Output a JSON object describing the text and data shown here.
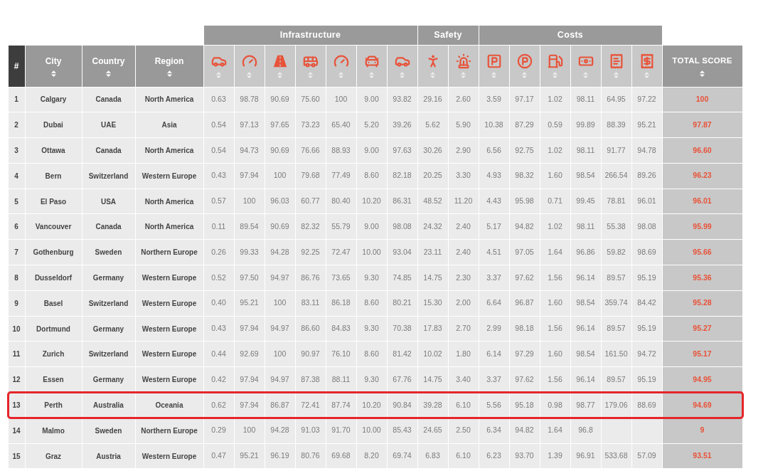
{
  "table": {
    "index_header": "#",
    "text_headers": [
      {
        "label": "City",
        "sortable": true
      },
      {
        "label": "Country",
        "sortable": true
      },
      {
        "label": "Region",
        "sortable": true
      }
    ],
    "groups": [
      {
        "title": "Infrastructure",
        "columns": [
          {
            "sortable": true
          },
          {
            "sortable": true
          },
          {
            "sortable": true
          },
          {
            "sortable": true
          },
          {
            "sortable": true
          },
          {
            "sortable": true
          },
          {
            "sortable": true
          }
        ]
      },
      {
        "title": "Safety",
        "columns": [
          {
            "sortable": true
          },
          {
            "sortable": true
          }
        ]
      },
      {
        "title": "Costs",
        "columns": [
          {
            "sortable": true
          },
          {
            "sortable": true
          },
          {
            "sortable": true
          },
          {
            "sortable": true
          },
          {
            "sortable": true
          },
          {
            "sortable": true
          }
        ]
      }
    ],
    "total_header": {
      "label": "TOTAL SCORE",
      "sortable": true
    },
    "rows": [
      {
        "rank": "1",
        "city": "Calgary",
        "country": "Canada",
        "region": "North America",
        "values": [
          "0.63",
          "98.78",
          "90.69",
          "75.60",
          "100",
          "9.00",
          "93.82",
          "29.16",
          "2.60",
          "3.59",
          "97.17",
          "1.02",
          "98.11",
          "64.95",
          "97.22"
        ],
        "total": "100",
        "highlighted": false
      },
      {
        "rank": "2",
        "city": "Dubai",
        "country": "UAE",
        "region": "Asia",
        "values": [
          "0.54",
          "97.13",
          "97.65",
          "73.23",
          "65.40",
          "5.20",
          "39.26",
          "5.62",
          "5.90",
          "10.38",
          "87.29",
          "0.59",
          "99.89",
          "88.39",
          "95.21"
        ],
        "total": "97.87",
        "highlighted": false
      },
      {
        "rank": "3",
        "city": "Ottawa",
        "country": "Canada",
        "region": "North America",
        "values": [
          "0.54",
          "94.73",
          "90.69",
          "76.66",
          "88.93",
          "9.00",
          "97.63",
          "30.26",
          "2.90",
          "6.56",
          "92.75",
          "1.02",
          "98.11",
          "91.77",
          "94.78"
        ],
        "total": "96.60",
        "highlighted": false
      },
      {
        "rank": "4",
        "city": "Bern",
        "country": "Switzerland",
        "region": "Western Europe",
        "values": [
          "0.43",
          "97.94",
          "100",
          "79.68",
          "77.49",
          "8.60",
          "82.18",
          "20.25",
          "3.30",
          "4.93",
          "98.32",
          "1.60",
          "98.54",
          "266.54",
          "89.26"
        ],
        "total": "96.23",
        "highlighted": false
      },
      {
        "rank": "5",
        "city": "El Paso",
        "country": "USA",
        "region": "North America",
        "values": [
          "0.57",
          "100",
          "96.03",
          "60.77",
          "80.40",
          "10.20",
          "86.31",
          "48.52",
          "11.20",
          "4.43",
          "95.98",
          "0.71",
          "99.45",
          "78.81",
          "96.01"
        ],
        "total": "96.01",
        "highlighted": false
      },
      {
        "rank": "6",
        "city": "Vancouver",
        "country": "Canada",
        "region": "North America",
        "values": [
          "0.11",
          "89.54",
          "90.69",
          "82.32",
          "55.79",
          "9.00",
          "98.08",
          "24.32",
          "2.40",
          "5.17",
          "94.82",
          "1.02",
          "98.11",
          "55.38",
          "98.08"
        ],
        "total": "95.99",
        "highlighted": false
      },
      {
        "rank": "7",
        "city": "Gothenburg",
        "country": "Sweden",
        "region": "Northern Europe",
        "values": [
          "0.26",
          "99.33",
          "94.28",
          "92.25",
          "72.47",
          "10.00",
          "93.04",
          "23.11",
          "2.40",
          "4.51",
          "97.05",
          "1.64",
          "96.86",
          "59.82",
          "98.69"
        ],
        "total": "95.66",
        "highlighted": false
      },
      {
        "rank": "8",
        "city": "Dusseldorf",
        "country": "Germany",
        "region": "Western Europe",
        "values": [
          "0.52",
          "97.50",
          "94.97",
          "86.76",
          "73.65",
          "9.30",
          "74.85",
          "14.75",
          "2.30",
          "3.37",
          "97.62",
          "1.56",
          "96.14",
          "89.57",
          "95.19"
        ],
        "total": "95.36",
        "highlighted": false
      },
      {
        "rank": "9",
        "city": "Basel",
        "country": "Switzerland",
        "region": "Western Europe",
        "values": [
          "0.40",
          "95.21",
          "100",
          "83.11",
          "86.18",
          "8.60",
          "80.21",
          "15.30",
          "2.00",
          "6.64",
          "96.87",
          "1.60",
          "98.54",
          "359.74",
          "84.42"
        ],
        "total": "95.28",
        "highlighted": false
      },
      {
        "rank": "10",
        "city": "Dortmund",
        "country": "Germany",
        "region": "Western Europe",
        "values": [
          "0.43",
          "97.94",
          "94.97",
          "86.60",
          "84.83",
          "9.30",
          "70.38",
          "17.83",
          "2.70",
          "2.99",
          "98.18",
          "1.56",
          "96.14",
          "89.57",
          "95.19"
        ],
        "total": "95.27",
        "highlighted": false
      },
      {
        "rank": "11",
        "city": "Zurich",
        "country": "Switzerland",
        "region": "Western Europe",
        "values": [
          "0.44",
          "92.69",
          "100",
          "90.97",
          "76.10",
          "8.60",
          "81.42",
          "10.02",
          "1.80",
          "6.14",
          "97.29",
          "1.60",
          "98.54",
          "161.50",
          "94.72"
        ],
        "total": "95.17",
        "highlighted": false
      },
      {
        "rank": "12",
        "city": "Essen",
        "country": "Germany",
        "region": "Western Europe",
        "values": [
          "0.42",
          "97.94",
          "94.97",
          "87.38",
          "88.11",
          "9.30",
          "67.76",
          "14.75",
          "3.40",
          "3.37",
          "97.62",
          "1.56",
          "96.14",
          "89.57",
          "95.19"
        ],
        "total": "94.95",
        "highlighted": false
      },
      {
        "rank": "13",
        "city": "Perth",
        "country": "Australia",
        "region": "Oceania",
        "values": [
          "0.62",
          "97.94",
          "86.87",
          "72.41",
          "87.74",
          "10.20",
          "90.84",
          "39.28",
          "6.10",
          "5.56",
          "95.18",
          "0.98",
          "98.77",
          "179.06",
          "88.69"
        ],
        "total": "94.69",
        "highlighted": true
      },
      {
        "rank": "14",
        "city": "Malmo",
        "country": "Sweden",
        "region": "Northern Europe",
        "values": [
          "0.29",
          "100",
          "94.28",
          "91.03",
          "91.70",
          "10.00",
          "85.43",
          "24.65",
          "2.50",
          "6.34",
          "94.82",
          "1.64",
          "96.8"
        ],
        "total": "9",
        "highlighted": false
      },
      {
        "rank": "15",
        "city": "Graz",
        "country": "Austria",
        "region": "Western Europe",
        "values": [
          "0.47",
          "95.21",
          "96.19",
          "80.76",
          "69.68",
          "8.20",
          "69.74",
          "6.83",
          "6.10",
          "6.23",
          "93.70",
          "1.39",
          "96.91",
          "533.68",
          "57.09"
        ],
        "total": "93.51",
        "highlighted": false
      }
    ]
  }
}
